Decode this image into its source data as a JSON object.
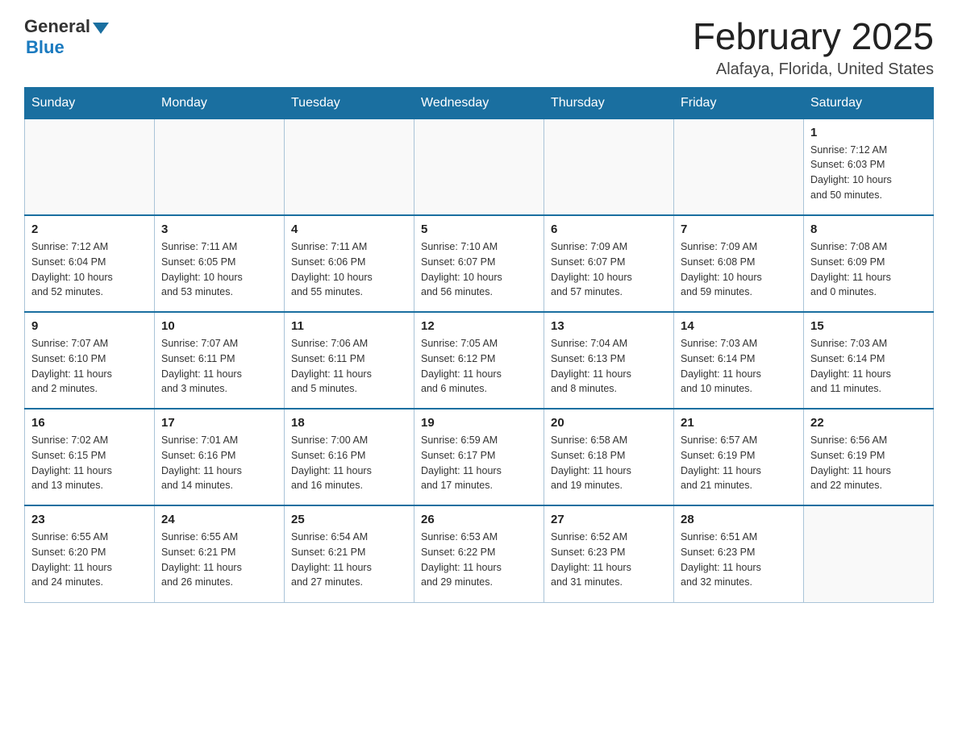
{
  "logo": {
    "general": "General",
    "blue": "Blue"
  },
  "header": {
    "month_title": "February 2025",
    "location": "Alafaya, Florida, United States"
  },
  "weekdays": [
    "Sunday",
    "Monday",
    "Tuesday",
    "Wednesday",
    "Thursday",
    "Friday",
    "Saturday"
  ],
  "weeks": [
    {
      "days": [
        {
          "number": "",
          "info": ""
        },
        {
          "number": "",
          "info": ""
        },
        {
          "number": "",
          "info": ""
        },
        {
          "number": "",
          "info": ""
        },
        {
          "number": "",
          "info": ""
        },
        {
          "number": "",
          "info": ""
        },
        {
          "number": "1",
          "info": "Sunrise: 7:12 AM\nSunset: 6:03 PM\nDaylight: 10 hours\nand 50 minutes."
        }
      ]
    },
    {
      "days": [
        {
          "number": "2",
          "info": "Sunrise: 7:12 AM\nSunset: 6:04 PM\nDaylight: 10 hours\nand 52 minutes."
        },
        {
          "number": "3",
          "info": "Sunrise: 7:11 AM\nSunset: 6:05 PM\nDaylight: 10 hours\nand 53 minutes."
        },
        {
          "number": "4",
          "info": "Sunrise: 7:11 AM\nSunset: 6:06 PM\nDaylight: 10 hours\nand 55 minutes."
        },
        {
          "number": "5",
          "info": "Sunrise: 7:10 AM\nSunset: 6:07 PM\nDaylight: 10 hours\nand 56 minutes."
        },
        {
          "number": "6",
          "info": "Sunrise: 7:09 AM\nSunset: 6:07 PM\nDaylight: 10 hours\nand 57 minutes."
        },
        {
          "number": "7",
          "info": "Sunrise: 7:09 AM\nSunset: 6:08 PM\nDaylight: 10 hours\nand 59 minutes."
        },
        {
          "number": "8",
          "info": "Sunrise: 7:08 AM\nSunset: 6:09 PM\nDaylight: 11 hours\nand 0 minutes."
        }
      ]
    },
    {
      "days": [
        {
          "number": "9",
          "info": "Sunrise: 7:07 AM\nSunset: 6:10 PM\nDaylight: 11 hours\nand 2 minutes."
        },
        {
          "number": "10",
          "info": "Sunrise: 7:07 AM\nSunset: 6:11 PM\nDaylight: 11 hours\nand 3 minutes."
        },
        {
          "number": "11",
          "info": "Sunrise: 7:06 AM\nSunset: 6:11 PM\nDaylight: 11 hours\nand 5 minutes."
        },
        {
          "number": "12",
          "info": "Sunrise: 7:05 AM\nSunset: 6:12 PM\nDaylight: 11 hours\nand 6 minutes."
        },
        {
          "number": "13",
          "info": "Sunrise: 7:04 AM\nSunset: 6:13 PM\nDaylight: 11 hours\nand 8 minutes."
        },
        {
          "number": "14",
          "info": "Sunrise: 7:03 AM\nSunset: 6:14 PM\nDaylight: 11 hours\nand 10 minutes."
        },
        {
          "number": "15",
          "info": "Sunrise: 7:03 AM\nSunset: 6:14 PM\nDaylight: 11 hours\nand 11 minutes."
        }
      ]
    },
    {
      "days": [
        {
          "number": "16",
          "info": "Sunrise: 7:02 AM\nSunset: 6:15 PM\nDaylight: 11 hours\nand 13 minutes."
        },
        {
          "number": "17",
          "info": "Sunrise: 7:01 AM\nSunset: 6:16 PM\nDaylight: 11 hours\nand 14 minutes."
        },
        {
          "number": "18",
          "info": "Sunrise: 7:00 AM\nSunset: 6:16 PM\nDaylight: 11 hours\nand 16 minutes."
        },
        {
          "number": "19",
          "info": "Sunrise: 6:59 AM\nSunset: 6:17 PM\nDaylight: 11 hours\nand 17 minutes."
        },
        {
          "number": "20",
          "info": "Sunrise: 6:58 AM\nSunset: 6:18 PM\nDaylight: 11 hours\nand 19 minutes."
        },
        {
          "number": "21",
          "info": "Sunrise: 6:57 AM\nSunset: 6:19 PM\nDaylight: 11 hours\nand 21 minutes."
        },
        {
          "number": "22",
          "info": "Sunrise: 6:56 AM\nSunset: 6:19 PM\nDaylight: 11 hours\nand 22 minutes."
        }
      ]
    },
    {
      "days": [
        {
          "number": "23",
          "info": "Sunrise: 6:55 AM\nSunset: 6:20 PM\nDaylight: 11 hours\nand 24 minutes."
        },
        {
          "number": "24",
          "info": "Sunrise: 6:55 AM\nSunset: 6:21 PM\nDaylight: 11 hours\nand 26 minutes."
        },
        {
          "number": "25",
          "info": "Sunrise: 6:54 AM\nSunset: 6:21 PM\nDaylight: 11 hours\nand 27 minutes."
        },
        {
          "number": "26",
          "info": "Sunrise: 6:53 AM\nSunset: 6:22 PM\nDaylight: 11 hours\nand 29 minutes."
        },
        {
          "number": "27",
          "info": "Sunrise: 6:52 AM\nSunset: 6:23 PM\nDaylight: 11 hours\nand 31 minutes."
        },
        {
          "number": "28",
          "info": "Sunrise: 6:51 AM\nSunset: 6:23 PM\nDaylight: 11 hours\nand 32 minutes."
        },
        {
          "number": "",
          "info": ""
        }
      ]
    }
  ]
}
